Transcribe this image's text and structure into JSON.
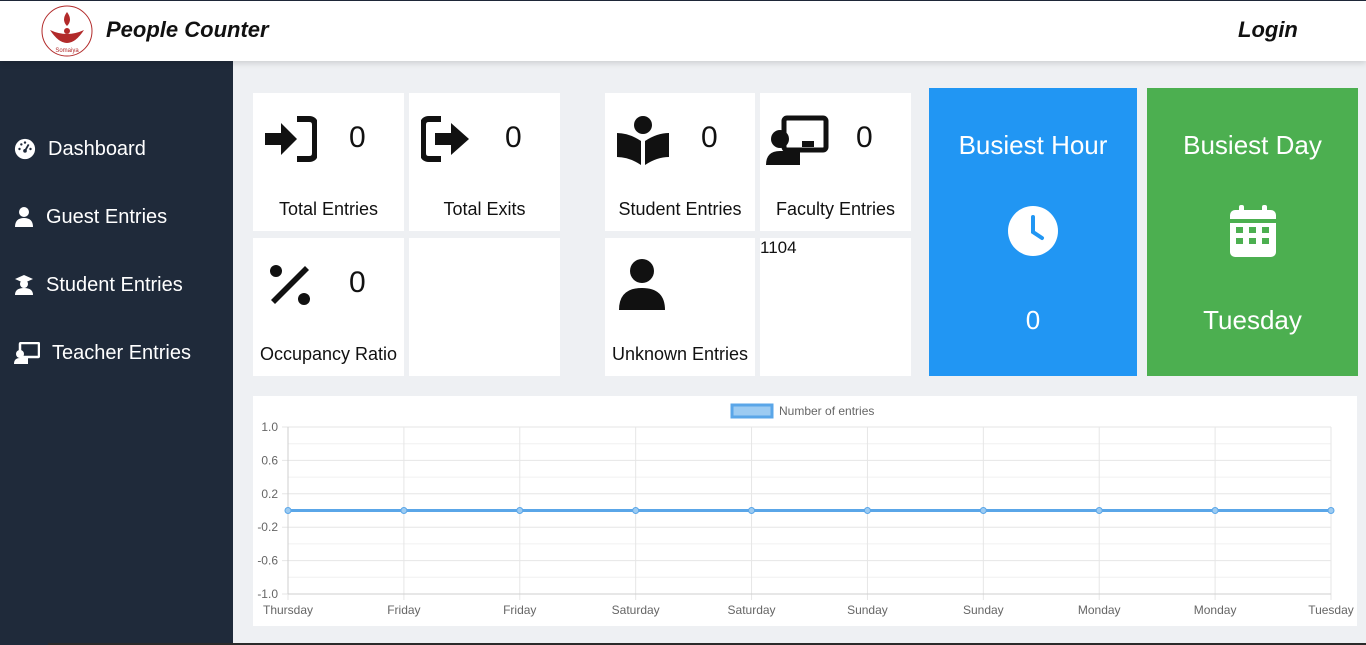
{
  "header": {
    "logo_alt": "Knowledge Alone Liberates - Somaiya Vidyavihar",
    "title": "People Counter",
    "login_label": "Login"
  },
  "sidebar": {
    "items": [
      {
        "label": "Dashboard",
        "icon": "dashboard-icon"
      },
      {
        "label": "Guest Entries",
        "icon": "user-icon"
      },
      {
        "label": "Student Entries",
        "icon": "graduate-icon"
      },
      {
        "label": "Teacher Entries",
        "icon": "teacher-icon"
      }
    ]
  },
  "cards": {
    "total_entries": {
      "value": "0",
      "label": "Total Entries"
    },
    "total_exits": {
      "value": "0",
      "label": "Total Exits"
    },
    "student_entries": {
      "value": "0",
      "label": "Student Entries"
    },
    "faculty_entries": {
      "value": "0",
      "label": "Faculty Entries"
    },
    "occupancy_ratio": {
      "value": "0",
      "label": "Occupancy Ratio"
    },
    "unknown_entries": {
      "label": "Unknown Entries"
    },
    "misc_value": "1104"
  },
  "busiest_hour": {
    "title": "Busiest Hour",
    "value": "0",
    "color": "#2196f3"
  },
  "busiest_day": {
    "title": "Busiest Day",
    "value": "Tuesday",
    "color": "#4caf50"
  },
  "chart_data": {
    "type": "line",
    "categories": [
      "Thursday",
      "Friday",
      "Friday",
      "Saturday",
      "Saturday",
      "Sunday",
      "Sunday",
      "Monday",
      "Monday",
      "Tuesday"
    ],
    "series": [
      {
        "name": "Number of entries",
        "values": [
          0,
          0,
          0,
          0,
          0,
          0,
          0,
          0,
          0,
          0
        ],
        "color": "#5aa6e8"
      }
    ],
    "ylim": [
      -1.0,
      1.0
    ],
    "yticks": [
      "1.0",
      "0.6",
      "0.2",
      "-0.2",
      "-0.6",
      "-1.0"
    ],
    "ytick_values": [
      1.0,
      0.6,
      0.2,
      -0.2,
      -0.6,
      -1.0
    ],
    "legend": "top-center",
    "grid": true
  }
}
